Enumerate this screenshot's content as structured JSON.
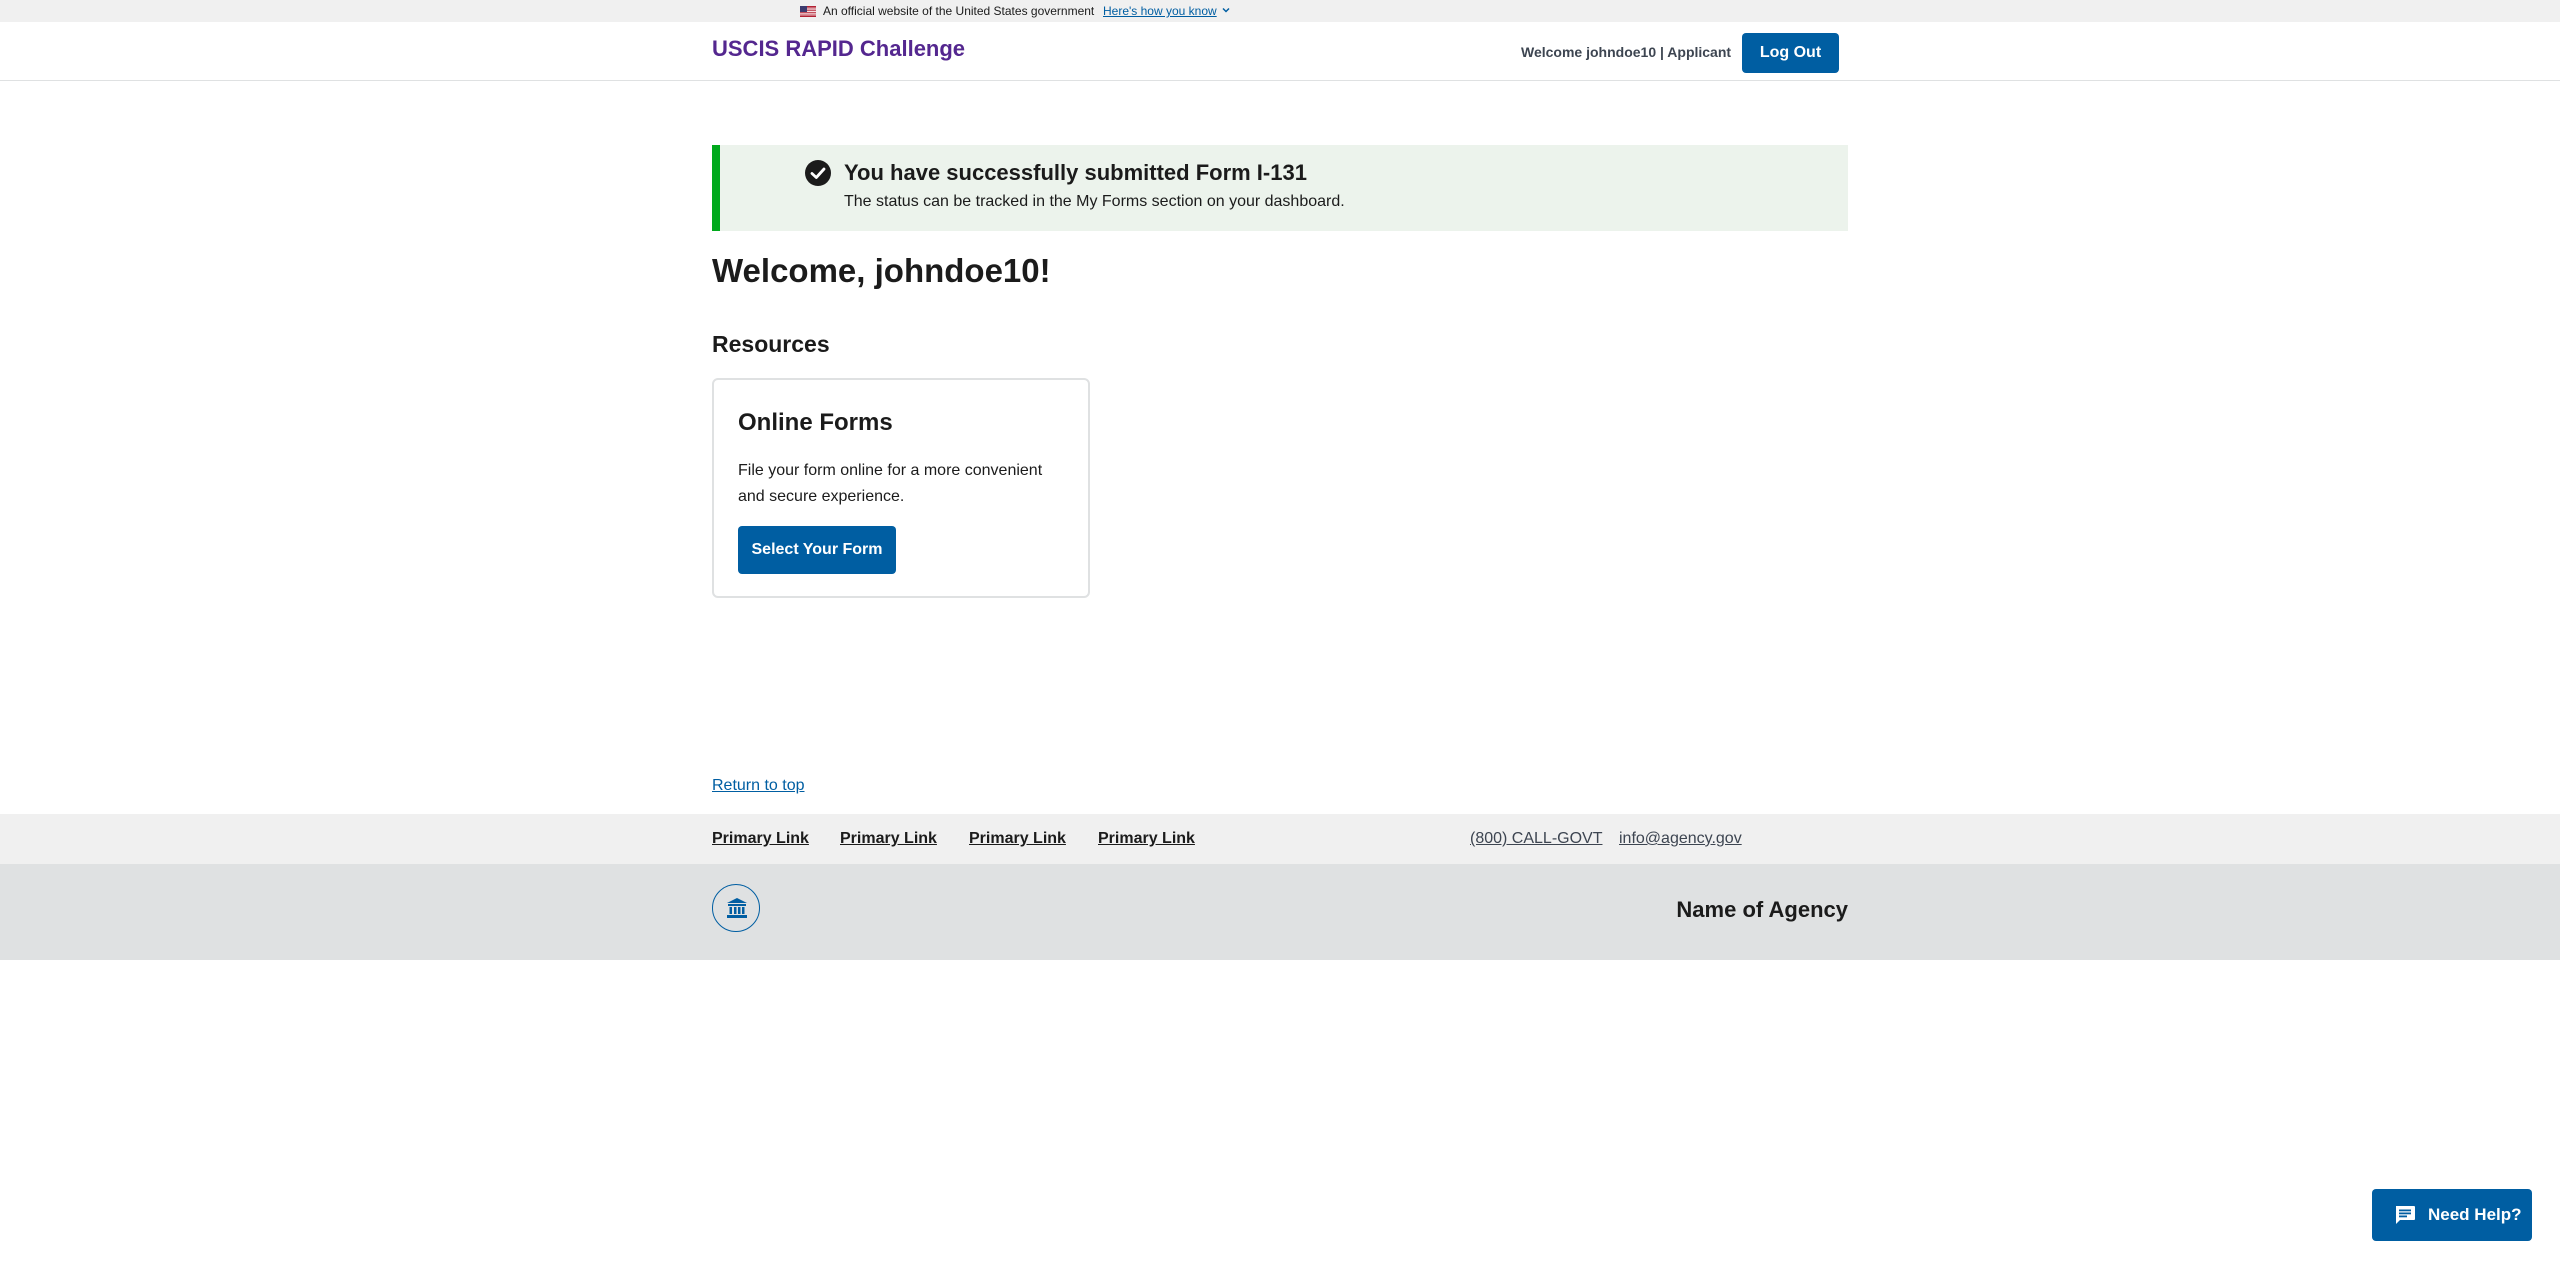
{
  "gov_banner": {
    "text": "An official website of the United States government",
    "link": "Here's how you know"
  },
  "header": {
    "title": "USCIS RAPID Challenge",
    "welcome": "Welcome johndoe10 | Applicant",
    "logout_label": "Log Out"
  },
  "alert": {
    "heading": "You have successfully submitted Form I-131",
    "body": "The status can be tracked in the My Forms section on your dashboard."
  },
  "main": {
    "welcome": "Welcome, johndoe10!",
    "resources_heading": "Resources",
    "card": {
      "title": "Online Forms",
      "text": "File your form online for a more convenient and secure experience.",
      "button": "Select Your Form"
    },
    "return_top": "Return to top"
  },
  "footer": {
    "links": [
      "Primary Link",
      "Primary Link",
      "Primary Link",
      "Primary Link"
    ],
    "phone": "(800) CALL-GOVT",
    "email": "info@agency.gov",
    "agency_name": "Name of Agency"
  },
  "help": {
    "label": "Need Help?"
  },
  "colors": {
    "primary": "#005ea2",
    "title": "#54278f",
    "success": "#00a91c",
    "success_bg": "#ecf3ec"
  }
}
